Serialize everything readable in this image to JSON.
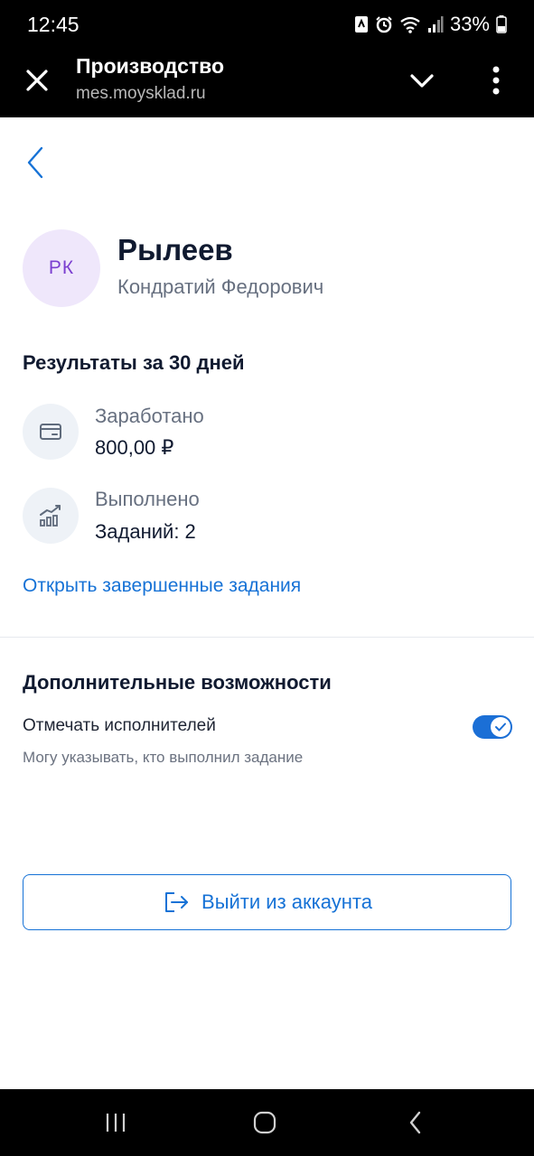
{
  "status_bar": {
    "time": "12:45",
    "battery": "33%"
  },
  "browser": {
    "title": "Производство",
    "url": "mes.moysklad.ru"
  },
  "profile": {
    "initials": "РК",
    "last_name": "Рылеев",
    "first_middle_name": "Кондратий Федорович"
  },
  "results": {
    "title": "Результаты за 30 дней",
    "earned_label": "Заработано",
    "earned_value": "800,00 ₽",
    "completed_label": "Выполнено",
    "completed_value": "Заданий: 2",
    "link": "Открыть завершенные задания"
  },
  "extra": {
    "title": "Дополнительные возможности",
    "option_label": "Отмечать исполнителей",
    "option_hint": "Могу указывать, кто выполнил задание",
    "option_enabled": true
  },
  "logout_label": "Выйти из аккаунта",
  "colors": {
    "accent": "#1672d6",
    "avatar_bg": "#efe7fb",
    "avatar_text": "#7b3fd0",
    "toggle_on": "#1b6fd6"
  }
}
